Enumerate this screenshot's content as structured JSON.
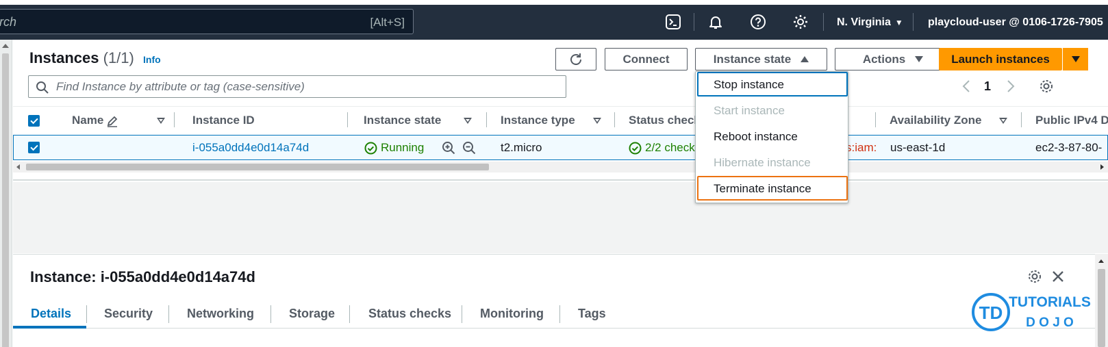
{
  "topbar": {
    "search_text": "rch",
    "search_shortcut": "[Alt+S]",
    "region": "N. Virginia",
    "account": "playcloud-user @ 0106-1726-7905",
    "icons": [
      "cloudshell-icon",
      "bell-icon",
      "help-icon",
      "gear-icon"
    ]
  },
  "instances": {
    "title": "Instances",
    "count": "(1/1)",
    "info": "Info",
    "buttons": {
      "connect": "Connect",
      "instance_state": "Instance state",
      "actions": "Actions",
      "launch": "Launch instances"
    },
    "filter_placeholder": "Find Instance by attribute or tag (case-sensitive)",
    "page": "1",
    "columns": [
      "Name",
      "Instance ID",
      "Instance state",
      "Instance type",
      "Status check",
      "Availability Zone",
      "Public IPv4 D"
    ],
    "row": {
      "name": "",
      "instance_id": "i-055a0dd4e0d14a74d",
      "state": "Running",
      "type": "t2.micro",
      "status_check": "2/2 check",
      "alarm_fragment": "s:iam:",
      "zone": "us-east-1d",
      "public_dns": "ec2-3-87-80-"
    }
  },
  "menu": {
    "items": [
      {
        "label": "Stop instance",
        "disabled": false
      },
      {
        "label": "Start instance",
        "disabled": true
      },
      {
        "label": "Reboot instance",
        "disabled": false
      },
      {
        "label": "Hibernate instance",
        "disabled": true
      },
      {
        "label": "Terminate instance",
        "disabled": false
      }
    ]
  },
  "details": {
    "title": "Instance: i-055a0dd4e0d14a74d",
    "tabs": [
      "Details",
      "Security",
      "Networking",
      "Storage",
      "Status checks",
      "Monitoring",
      "Tags"
    ]
  },
  "watermark": {
    "line1": "TUTORIALS",
    "line2": "D O J O",
    "logo": "TD"
  },
  "colors": {
    "nav_bg": "#232f3e",
    "accent": "#0073bb",
    "primary": "#ff9900",
    "success": "#1d8102",
    "terminate_focus": "#ec7211"
  }
}
